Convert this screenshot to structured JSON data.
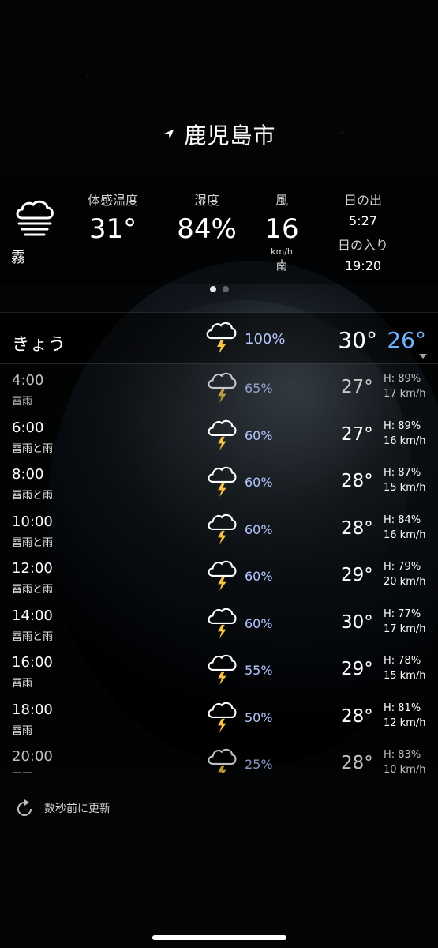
{
  "location": {
    "city": "鹿児島市"
  },
  "summary": {
    "condition": "霧",
    "feels_like": {
      "label": "体感温度",
      "value": "31°"
    },
    "humidity": {
      "label": "湿度",
      "value": "84%"
    },
    "wind": {
      "label": "風",
      "value": "16",
      "unit": "km/h",
      "direction": "南"
    },
    "sun": {
      "sunrise_label": "日の出",
      "sunrise": "5:27",
      "sunset_label": "日の入り",
      "sunset": "19:20"
    }
  },
  "page_indicator": {
    "current": 1,
    "total": 2
  },
  "today": {
    "label": "きょう",
    "precip": "100%",
    "high": "30°",
    "low": "26°"
  },
  "hourly": [
    {
      "time": "4:00",
      "desc": "雷雨",
      "precip": "65%",
      "temp": "27°",
      "humidity": "H: 89%",
      "wind": "17 km/h"
    },
    {
      "time": "6:00",
      "desc": "雷雨と雨",
      "precip": "60%",
      "temp": "27°",
      "humidity": "H: 89%",
      "wind": "16 km/h"
    },
    {
      "time": "8:00",
      "desc": "雷雨と雨",
      "precip": "60%",
      "temp": "28°",
      "humidity": "H: 87%",
      "wind": "15 km/h"
    },
    {
      "time": "10:00",
      "desc": "雷雨と雨",
      "precip": "60%",
      "temp": "28°",
      "humidity": "H: 84%",
      "wind": "16 km/h"
    },
    {
      "time": "12:00",
      "desc": "雷雨と雨",
      "precip": "60%",
      "temp": "29°",
      "humidity": "H: 79%",
      "wind": "20 km/h"
    },
    {
      "time": "14:00",
      "desc": "雷雨と雨",
      "precip": "60%",
      "temp": "30°",
      "humidity": "H: 77%",
      "wind": "17 km/h"
    },
    {
      "time": "16:00",
      "desc": "雷雨",
      "precip": "55%",
      "temp": "29°",
      "humidity": "H: 78%",
      "wind": "15 km/h"
    },
    {
      "time": "18:00",
      "desc": "雷雨",
      "precip": "50%",
      "temp": "28°",
      "humidity": "H: 81%",
      "wind": "12 km/h"
    },
    {
      "time": "20:00",
      "desc": "雷雨",
      "precip": "25%",
      "temp": "28°",
      "humidity": "H: 83%",
      "wind": "10 km/h"
    }
  ],
  "footer": {
    "updated": "数秒前に更新"
  },
  "colors": {
    "precip": "#b5c7ff",
    "low_temp": "#6fb3ff",
    "bolt": "#f6c343"
  },
  "icons": {
    "location": "location-arrow-icon",
    "condition": "fog-icon",
    "thunder": "thunderstorm-icon",
    "refresh": "refresh-icon"
  }
}
